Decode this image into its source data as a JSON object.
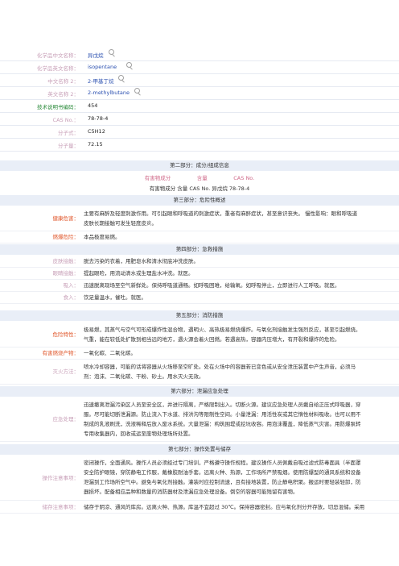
{
  "identity": {
    "rows": [
      {
        "label": "化学品中文名称：",
        "value": "异戊烷",
        "has_icon": true
      },
      {
        "label": "化学品英文名称：",
        "value": "isopentane",
        "has_icon": true
      },
      {
        "label": "中文名称 2：",
        "value": "2-甲基丁烷",
        "has_icon": true
      },
      {
        "label": "英文名称 2：",
        "value": "2-methylbutane",
        "has_icon": true
      },
      {
        "label": "技术说明书编码：",
        "value": "454",
        "has_icon": false
      },
      {
        "label": "CAS No.：",
        "value": "78-78-4",
        "has_icon": false
      },
      {
        "label": "分子式：",
        "value": "C5H12",
        "has_icon": false
      },
      {
        "label": "分子量：",
        "value": "72.15",
        "has_icon": false
      }
    ]
  },
  "part2": {
    "title": "第二部分：成分/组成信息",
    "header_line": "有害物成分　　　　　含量　　　　　CAS No.",
    "data_line": "有害物成分  含量  CAS No. 异戊烷  78-78-4"
  },
  "part3": {
    "title": "第三部分：危险性概述",
    "rows": [
      {
        "label": "健康危害：",
        "text": "主要有麻醉及轻度刺激作用。可引起眼和呼吸道的刺激症状，重者有麻醉症状，甚至意识丧失。  慢性影响：眼和呼吸道\n皮肤长期接触可发生轻度皮炎。"
      },
      {
        "label": "燃爆危险：",
        "text": "本品极度易燃。"
      }
    ]
  },
  "part4": {
    "title": "第四部分：急救措施",
    "rows": [
      {
        "label": "皮肤接触：",
        "text": "脱去污染的衣着，用肥皂水和清水彻底冲洗皮肤。"
      },
      {
        "label": "眼睛接触：",
        "text": "提起眼睑，用流动清水或生理盐水冲洗。就医。"
      },
      {
        "label": "吸入：",
        "text": "迅速脱离现场至空气新鲜处。保持呼吸道通畅。如呼吸困难，给输氧。如呼吸停止，立即进行人工呼吸。就医。"
      },
      {
        "label": "食入：",
        "text": "饮足量温水，催吐。就医。"
      }
    ]
  },
  "part5": {
    "title": "第五部分：消防措施",
    "rows": [
      {
        "label": "危险特性：",
        "text": "极易燃，其蒸气与空气可形成爆炸性混合物，遇明火、高热极易燃烧爆炸。与氧化剂接触发生强烈反应，甚至引起燃烧。\n气重，能在较低处扩散到相当远的地方，遇火源会着火回燃。若遇高热，容器内压增大，有开裂和爆炸的危险。"
      },
      {
        "label": "有害燃烧产物：",
        "text": "一氧化碳、二氧化碳。"
      },
      {
        "label": "灭火方法：",
        "text": "喷水冷却容器，可能的话将容器从火场移至空旷处。处在火场中的容器若已变色或从安全泄压装置中产生声音，必须马\n剂：泡沫、二氧化碳、干粉、砂土。用水灭火无效。"
      }
    ]
  },
  "part6": {
    "title": "第六部分：泄漏应急处理",
    "rows": [
      {
        "label": "应急处理：",
        "text": "迅速撤离泄漏污染区人员至安全区，并进行隔离，严格限制出入。切断火源。建议应急处理人员戴自给正压式呼吸器，穿\n服。尽可能切断泄漏源。防止流入下水道、排洪沟等限制性空间。小量泄漏：用活性炭或其它惰性材料吸收。也可以用不\n制成的乳液刷洗，洗液稀释后放入废水系统。大量泄漏：构筑围堤或挖坑收容。用泡沫覆盖，降低蒸气灾害。用防爆泵转\n专用收集器内，回收或运至废物处理场所处置。"
      }
    ]
  },
  "part7": {
    "title": "第七部分：操作处置与储存",
    "rows": [
      {
        "label": "操作注意事项：",
        "text": "密闭操作，全面通风。操作人员必须经过专门培训，严格遵守操作规程。建议操作人员佩戴自吸过滤式防毒面具（半面罩\n安全防护眼镜，穿防静电工作服，戴橡胶耐油手套。远离火种、热源，工作场所严禁吸烟。使用防爆型的通风系统和设备\n泄漏到工作场所空气中。避免与氧化剂接触。灌装时应控制流速，且有接地装置，防止静电积聚。搬运时要轻装轻卸，防\n器损坏。配备相应品种和数量的消防器材及泄漏应急处理设备。倒空的容器可能残留有害物。"
      },
      {
        "label": "储存注意事项：",
        "text": "储存于阴凉、通风的库房。远离火种、热源。库温不宜超过 30℃。保持容器密封。应与氧化剂分开存放，切忌混储。采用"
      }
    ]
  },
  "colors": {
    "label_orange": "#e0572b",
    "label_pink": "#c8a0b8",
    "label_blue": "#6a8fd0",
    "label_green": "#2a8a3a",
    "value_blue": "#2a4fb0",
    "section_header_bg": "#e9eef7"
  },
  "icons": {
    "search": "magnifier-icon"
  }
}
